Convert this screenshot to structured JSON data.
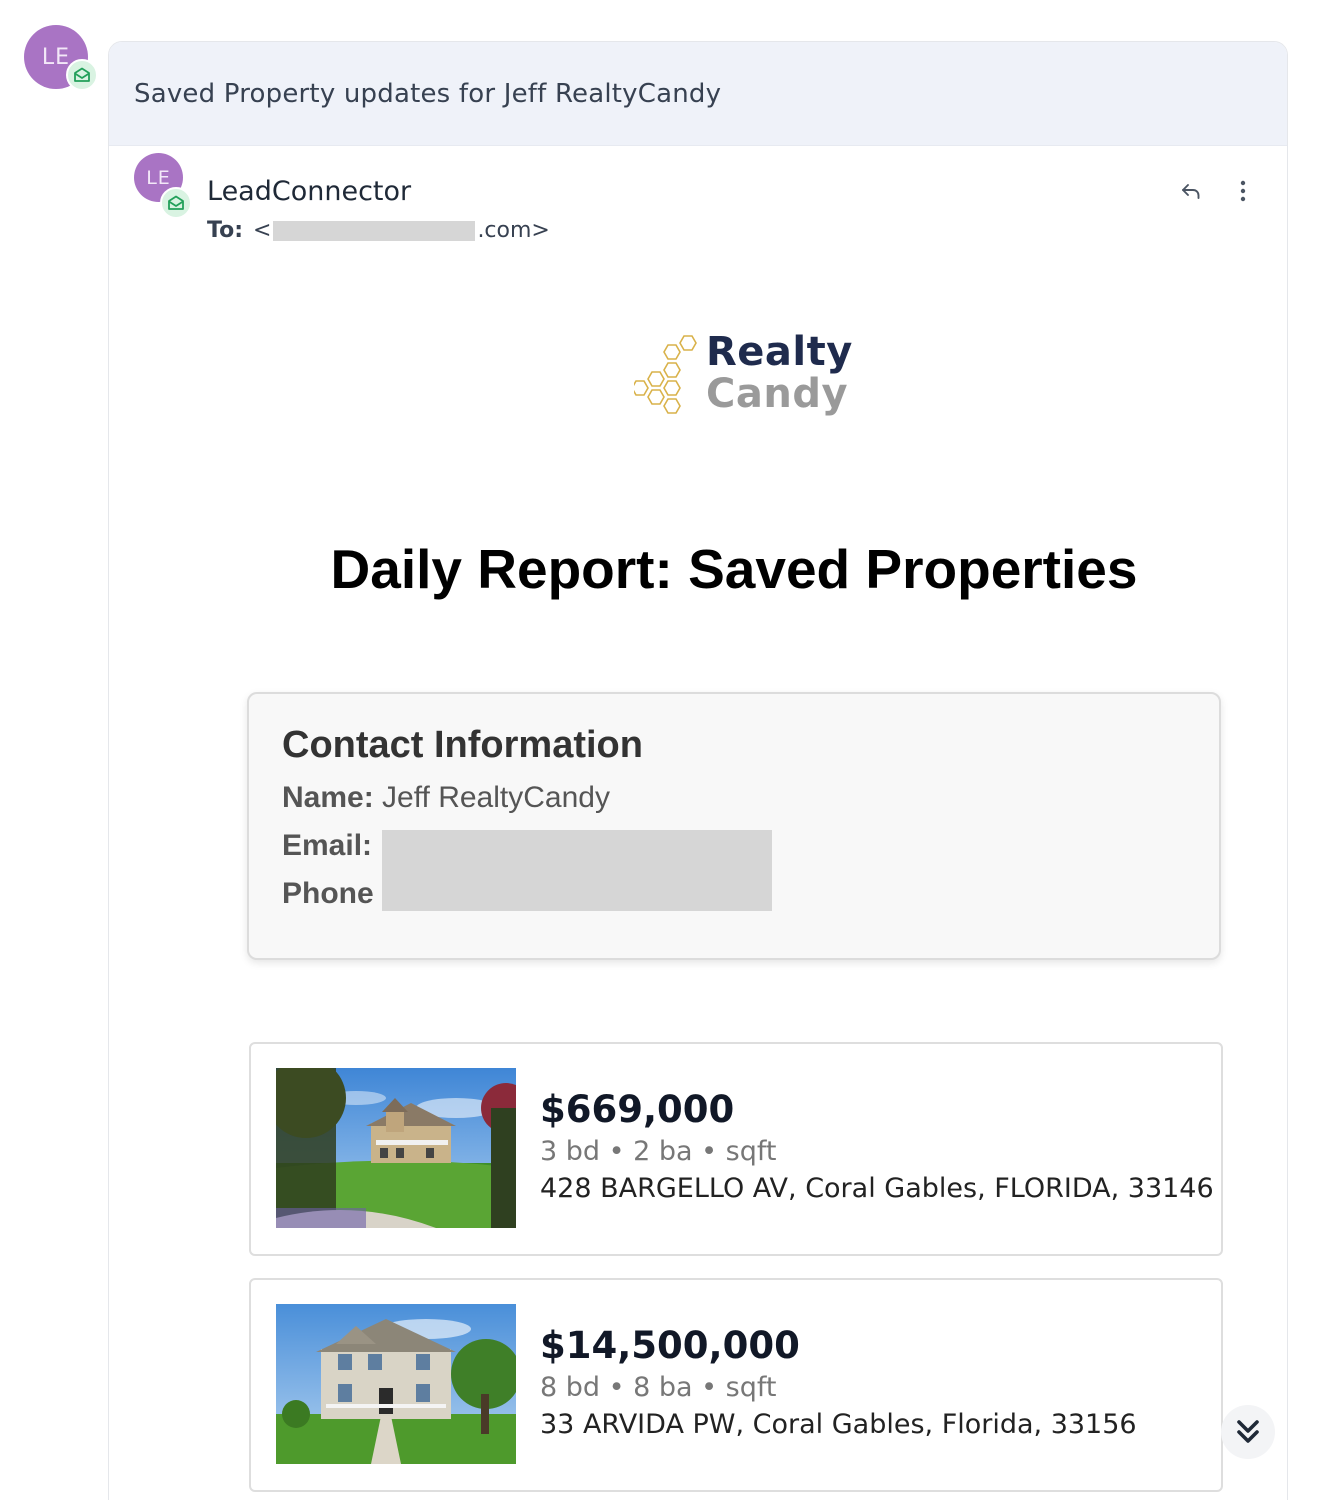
{
  "thread": {
    "avatar_initials": "LE",
    "subject": "Saved Property updates for Jeff RealtyCandy"
  },
  "message": {
    "avatar_initials": "LE",
    "sender": "LeadConnector",
    "to_label": "To:",
    "to_prefix": "<",
    "to_suffix": ".com>"
  },
  "logo": {
    "line1": "Realty",
    "line2": "Candy"
  },
  "report": {
    "title": "Daily Report: Saved Properties"
  },
  "contact": {
    "heading": "Contact Information",
    "name_label": "Name:",
    "name_value": "Jeff RealtyCandy",
    "email_label": "Email:",
    "phone_label": "Phone"
  },
  "listings": [
    {
      "price": "$669,000",
      "meta": "3 bd • 2 ba • sqft",
      "address": "428 BARGELLO AV, Coral Gables, FLORIDA, 33146"
    },
    {
      "price": "$14,500,000",
      "meta": "8 bd • 8 ba • sqft",
      "address": "33 ARVIDA PW, Coral Gables, Florida, 33156"
    }
  ],
  "colors": {
    "avatar": "#a974c4",
    "subject_bar": "#eff2f9",
    "badge": "#d9f3e2",
    "badge_icon": "#22a05a",
    "logo_navy": "#1f2b4d",
    "logo_gold": "#d9b24a"
  },
  "icons": {
    "reply": "reply-icon",
    "more": "more-vertical-icon",
    "scroll": "chevrons-down-icon",
    "badge": "mail-open-icon"
  }
}
